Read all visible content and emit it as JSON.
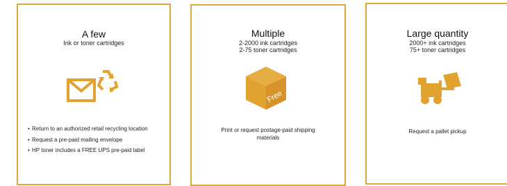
{
  "cards": [
    {
      "heading": "A few",
      "sub_lines": [
        "Ink or toner cartridges"
      ],
      "icon": "recycle-envelope-icon",
      "bullets": [
        "Return to an authorized retail recycling location",
        "Request a pre-paid mailing envelope",
        "HP toner includes a FREE UPS pre-paid label"
      ]
    },
    {
      "heading": "Multiple",
      "sub_lines": [
        "2-2000 ink cartridges",
        "2-75 toner cartridges"
      ],
      "icon": "free-box-icon",
      "box_label": "Free",
      "description": "Print or request postage-paid shipping materials"
    },
    {
      "heading": "Large quantity",
      "sub_lines": [
        "2000+ ink cartridges",
        "75+ toner cartridges"
      ],
      "icon": "forklift-pallet-icon",
      "description": "Request a pallet pickup"
    }
  ],
  "colors": {
    "accent": "#e0a63c",
    "icon_fill": "#e2a22f",
    "text": "#222222"
  }
}
